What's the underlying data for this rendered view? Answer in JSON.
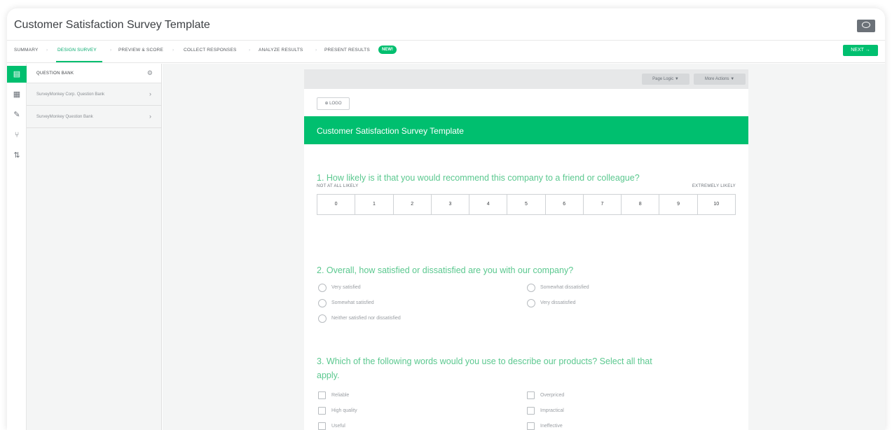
{
  "window": {
    "title": "Customer Satisfaction Survey Template"
  },
  "steps": {
    "items": [
      {
        "label": "SUMMARY",
        "active": false
      },
      {
        "label": "DESIGN SURVEY",
        "active": true
      },
      {
        "label": "PREVIEW & SCORE",
        "active": false
      },
      {
        "label": "COLLECT RESPONSES",
        "active": false
      },
      {
        "label": "ANALYZE RESULTS",
        "active": false
      },
      {
        "label": "PRESENT RESULTS",
        "active": false
      }
    ],
    "new_badge": "NEW!",
    "next_label": "NEXT →"
  },
  "rail": {
    "icons": [
      "question-bank-icon",
      "builder-icon",
      "style-icon",
      "logic-icon",
      "options-icon"
    ],
    "active": "question-bank-icon"
  },
  "panel": {
    "title": "QUESTION BANK",
    "items": [
      {
        "label": "SurveyMonkey Corp. Question Bank"
      },
      {
        "label": "SurveyMonkey Question Bank"
      }
    ]
  },
  "survey": {
    "page_logic_label": "Page Logic ▼",
    "more_actions_label": "More Actions ▼",
    "logo_label": "⊕ LOGO",
    "banner_title": "Customer Satisfaction Survey Template",
    "q1": {
      "text": "1. How likely is it that you would recommend this company to a friend or colleague?",
      "low_label": "NOT AT ALL LIKELY",
      "high_label": "EXTREMELY LIKELY",
      "scale": [
        "0",
        "1",
        "2",
        "3",
        "4",
        "5",
        "6",
        "7",
        "8",
        "9",
        "10"
      ]
    },
    "q2": {
      "text": "2. Overall, how satisfied or dissatisfied are you with our company?",
      "options": [
        "Very satisfied",
        "Somewhat satisfied",
        "Neither satisfied nor dissatisfied",
        "Somewhat dissatisfied",
        "Very dissatisfied"
      ]
    },
    "q3": {
      "text_line1": "3. Which of the following words would you use to describe our products? Select all that",
      "text_line2": "apply.",
      "options": [
        "Reliable",
        "High quality",
        "Useful",
        "Overpriced",
        "Impractical",
        "Ineffective"
      ]
    }
  },
  "colors": {
    "accent": "#00bf6f",
    "question_text": "#5bc88f"
  }
}
